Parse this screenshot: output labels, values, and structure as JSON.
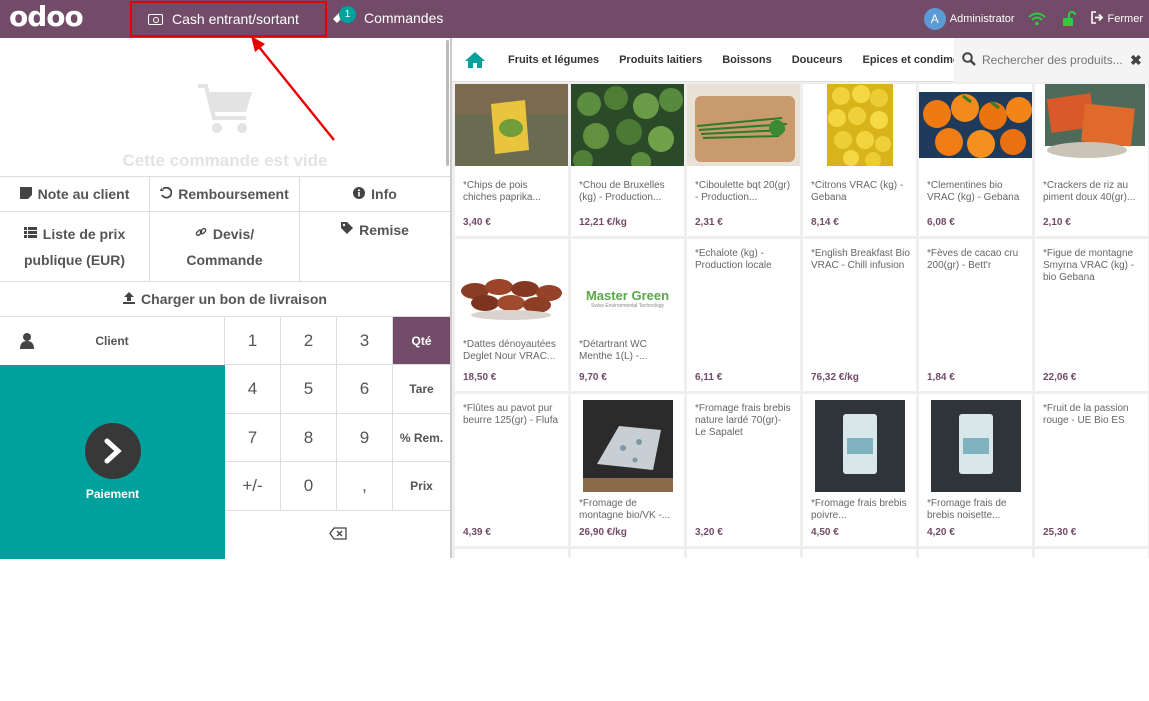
{
  "topbar": {
    "logo": "odoo",
    "cash_label": "Cash entrant/sortant",
    "orders_badge": "1",
    "orders_label": "Commandes",
    "user_initial": "A",
    "user_name": "Administrator",
    "close_label": "Fermer"
  },
  "order": {
    "empty_text": "Cette commande est vide"
  },
  "controls": {
    "note": "Note au client",
    "refund": "Remboursement",
    "info": "Info",
    "pricelist_line1": "Liste de prix",
    "pricelist_line2": "publique (EUR)",
    "quote_line1": "Devis/",
    "quote_line2": "Commande",
    "discount": "Remise",
    "delivery": "Charger un bon de livraison"
  },
  "numpad": {
    "client": "Client",
    "payment": "Paiement",
    "keys": [
      "1",
      "2",
      "3",
      "Qté",
      "4",
      "5",
      "6",
      "Tare",
      "7",
      "8",
      "9",
      "% Rem.",
      "+/-",
      "0",
      ",",
      "Prix"
    ]
  },
  "categories": [
    "Fruits et légumes",
    "Produits laitiers",
    "Boissons",
    "Douceurs",
    "Epices et condiments"
  ],
  "search": {
    "placeholder": "Rechercher des produits..."
  },
  "products": [
    {
      "name": "*Chips de pois chiches paprika...",
      "price": "3,40 €"
    },
    {
      "name": "*Chou de Bruxelles (kg) - Production...",
      "price": "12,21 €/kg"
    },
    {
      "name": "*Ciboulette bqt 20(gr) - Production...",
      "price": "2,31 €"
    },
    {
      "name": "*Citrons VRAC (kg) - Gebana",
      "price": "8,14 €"
    },
    {
      "name": "*Clementines bio VRAC (kg) - Gebana",
      "price": "6,08 €"
    },
    {
      "name": "*Crackers de riz au piment doux 40(gr)...",
      "price": "2,10 €"
    },
    {
      "name": "*Dattes dénoyautées Deglet Nour VRAC...",
      "price": "18,50 €"
    },
    {
      "name": "*Détartrant WC Menthe 1(L) -...",
      "price": "9,70 €"
    },
    {
      "name": "*Echalote (kg) - Production locale",
      "price": "6,11 €"
    },
    {
      "name": "*English Breakfast Bio VRAC - Chill infusion",
      "price": "76,32 €/kg"
    },
    {
      "name": "*Fèves de cacao cru 200(gr) - Bett'r",
      "price": "1,84 €"
    },
    {
      "name": "*Figue de montagne Smyrna VRAC (kg) - bio Gebana",
      "price": "22,06 €"
    },
    {
      "name": "*Flûtes au pavot pur beurre 125(gr) - Flufa",
      "price": "4,39 €"
    },
    {
      "name": "*Fromage de montagne bio/VK -...",
      "price": "26,90 €/kg"
    },
    {
      "name": "*Fromage frais brebis nature lardé 70(gr)- Le Sapalet",
      "price": "3,20 €"
    },
    {
      "name": "*Fromage frais brebis poivre...",
      "price": "4,50 €"
    },
    {
      "name": "*Fromage frais de brebis noisette...",
      "price": "4,20 €"
    },
    {
      "name": "*Fruit de la passion rouge - UE Bio ES",
      "price": "25,30 €"
    }
  ],
  "brand_logo_text": "Master Green",
  "brand_logo_sub": "Swiss Environmental Technology"
}
